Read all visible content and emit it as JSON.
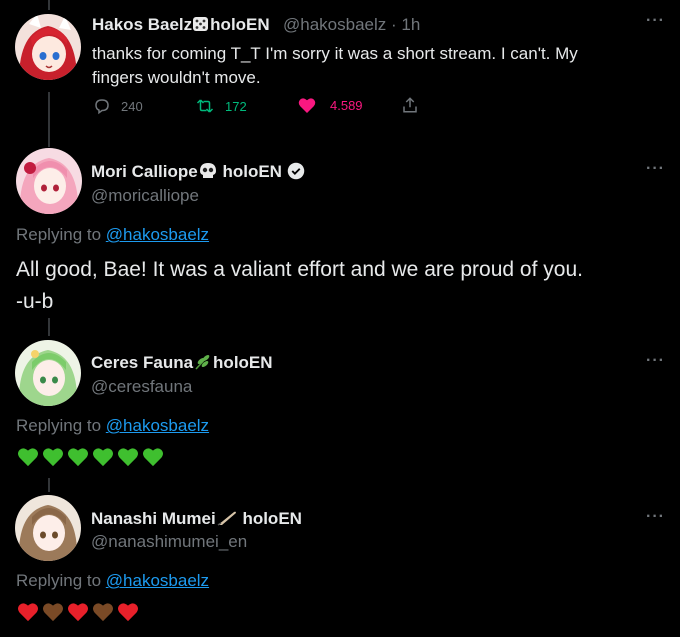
{
  "tweet_main": {
    "author": "Hakos Baelz",
    "suffix": "holoEN",
    "handle": "@hakosbaelz",
    "time": "· 1h",
    "text_line1": "thanks for coming T_T I'm sorry it was a short stream. I can't. My",
    "text_line2": "fingers wouldn't move.",
    "replies": "240",
    "retweets": "172",
    "likes": "4.589"
  },
  "reply1": {
    "author": "Mori Calliope",
    "suffix": "holoEN",
    "handle": "@moricalliope",
    "replying_prefix": "Replying to",
    "replying_to": "@hakosbaelz",
    "text_line1": "All good, Bae! It was a valiant effort and we are proud of you.",
    "text_line2": "-u-b"
  },
  "reply2": {
    "author": "Ceres Fauna",
    "suffix": "holoEN",
    "handle": "@ceresfauna",
    "replying_prefix": "Replying to",
    "replying_to": "@hakosbaelz"
  },
  "reply3": {
    "author": "Nanashi Mumei",
    "suffix": "holoEN",
    "handle": "@nanashimumei_en",
    "replying_prefix": "Replying to",
    "replying_to": "@hakosbaelz"
  },
  "icons": {
    "more": "more-icon",
    "reply": "reply-icon",
    "retweet": "retweet-icon",
    "like": "heart-icon",
    "share": "share-icon",
    "verified": "verified-badge-icon"
  },
  "colors": {
    "background": "#000000",
    "text": "#e7e9ea",
    "muted": "#71767b",
    "link": "#1d9bf0",
    "retweet": "#00ba7c",
    "like": "#f91880",
    "green_heart": "#3fbf2f",
    "red_heart": "#e8202a",
    "brown_heart": "#7a4a26"
  }
}
